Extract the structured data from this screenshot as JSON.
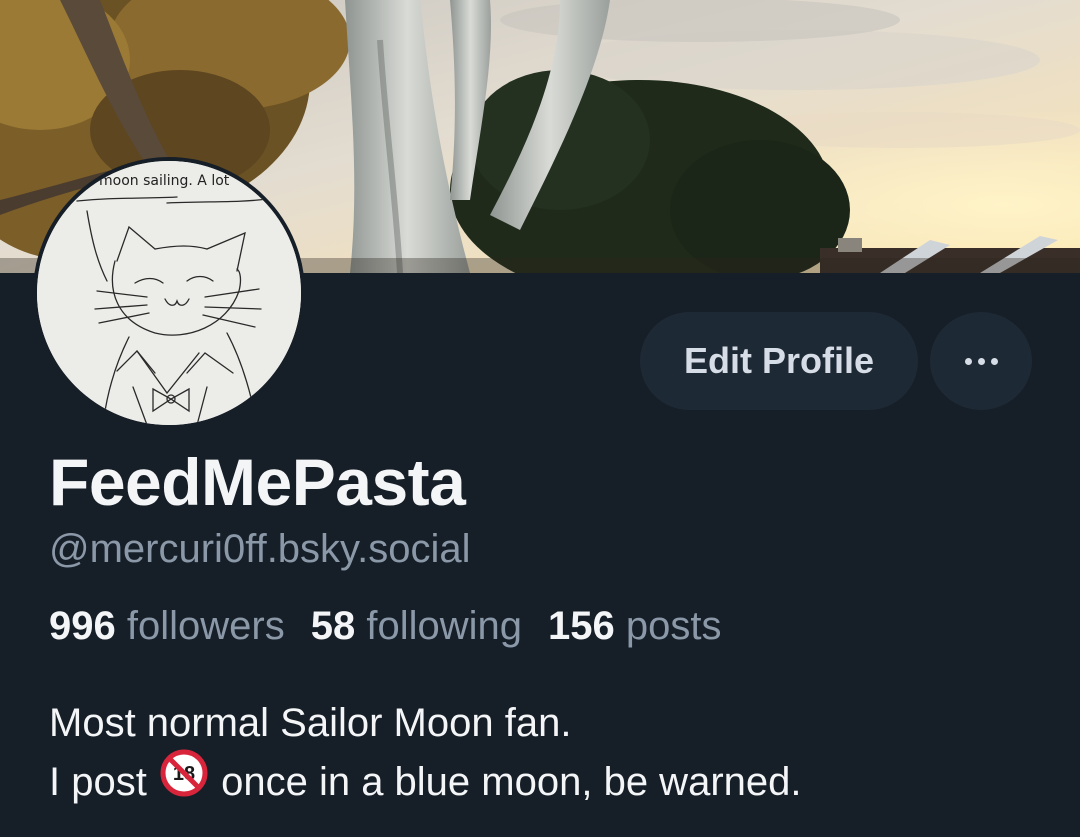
{
  "avatar": {
    "caption": "moon sailing. A lot"
  },
  "actions": {
    "edit_profile_label": "Edit Profile",
    "more_icon": "ellipsis-icon"
  },
  "profile": {
    "display_name": "FeedMePasta",
    "handle": "@mercuri0ff.bsky.social"
  },
  "stats": {
    "followers_count": "996",
    "followers_label": "followers",
    "following_count": "58",
    "following_label": "following",
    "posts_count": "156",
    "posts_label": "posts"
  },
  "bio": {
    "line1": "Most normal Sailor Moon fan.",
    "line2_before": "I post",
    "age_icon_text": "18",
    "age_icon": "no-under-18-icon",
    "line2_after": "once in a blue moon, be warned."
  },
  "colors": {
    "background": "#161e27",
    "button_bg": "#1e2936",
    "secondary_text": "#8a98a8",
    "primary_text": "#f3f5f7",
    "age_icon_red": "#d9253b"
  }
}
